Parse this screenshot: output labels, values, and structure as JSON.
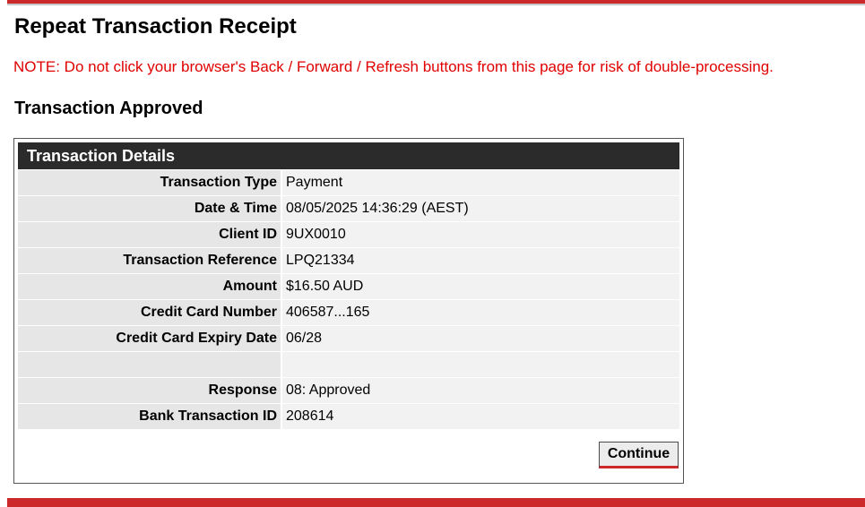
{
  "page": {
    "title": "Repeat Transaction Receipt",
    "warning": "NOTE: Do not click your browser's Back / Forward / Refresh buttons from this page for risk of double-processing.",
    "status": "Transaction Approved"
  },
  "details": {
    "header": "Transaction Details",
    "rows": [
      {
        "label": "Transaction Type",
        "value": "Payment"
      },
      {
        "label": "Date & Time",
        "value": "08/05/2025 14:36:29 (AEST)"
      },
      {
        "label": "Client ID",
        "value": "9UX0010"
      },
      {
        "label": "Transaction Reference",
        "value": "LPQ21334"
      },
      {
        "label": "Amount",
        "value": "$16.50 AUD"
      },
      {
        "label": "Credit Card Number",
        "value": "406587...165"
      },
      {
        "label": "Credit Card Expiry Date",
        "value": "06/28"
      },
      {
        "label": "",
        "value": ""
      },
      {
        "label": "Response",
        "value": "08: Approved"
      },
      {
        "label": "Bank Transaction ID",
        "value": "208614"
      }
    ]
  },
  "actions": {
    "continue_label": "Continue"
  },
  "colors": {
    "accent_red": "#cc2a2a",
    "warning_red": "#e00000",
    "header_bg": "#2b2b2b",
    "label_bg": "#e6e6e6",
    "value_bg": "#f2f2f2"
  }
}
